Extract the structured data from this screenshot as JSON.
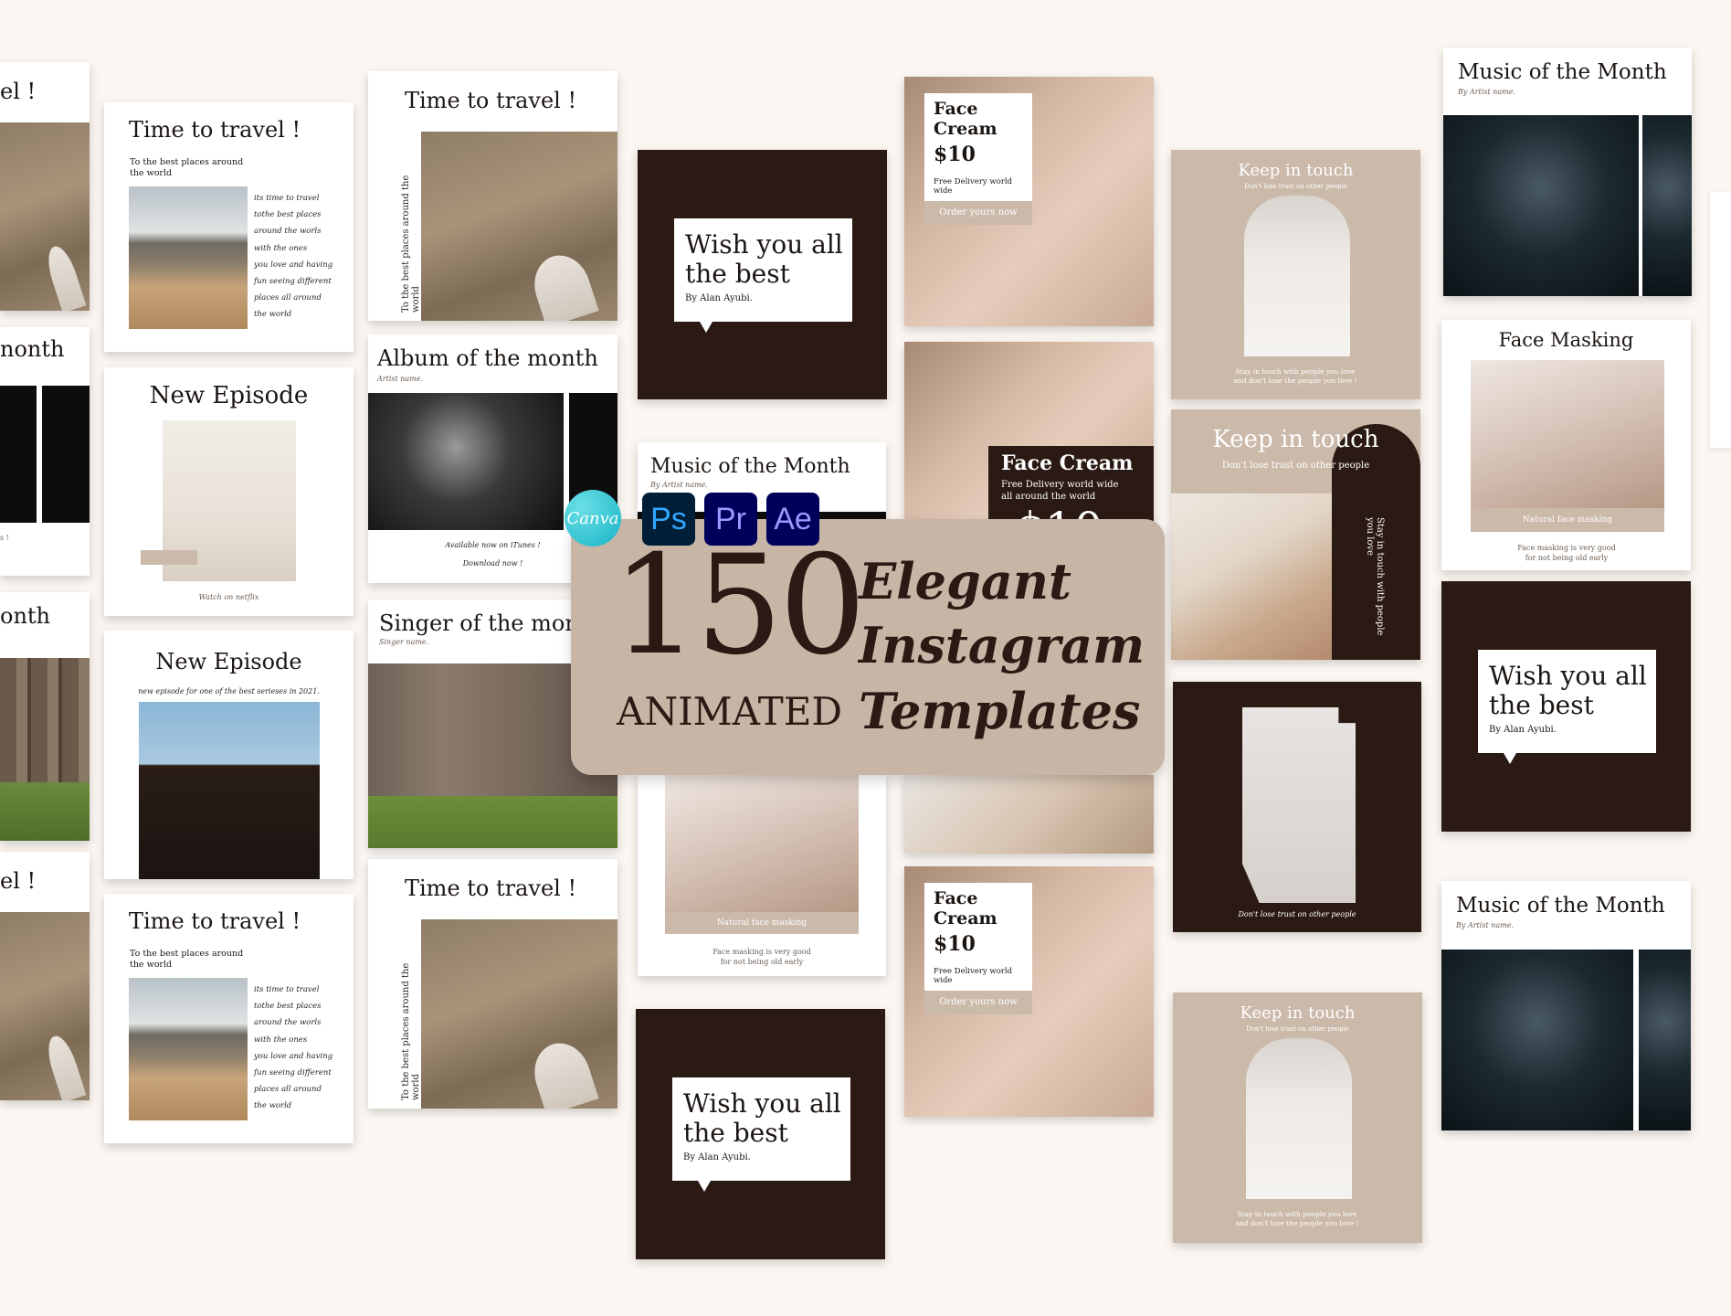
{
  "banner": {
    "number": "150",
    "animated": "ANIMATED",
    "line1": "Elegant",
    "line2": "Instagram",
    "line3": "Templates",
    "apps": [
      "Canva",
      "Ps",
      "Pr",
      "Ae"
    ]
  },
  "texts": {
    "travel_title": "Time to travel !",
    "travel_sub": "To the best places around the world",
    "travel_body": [
      "its time to travel",
      "tothe best places",
      "around the worls",
      "with the ones",
      "you love and having",
      "fun seeing different",
      "places all around",
      "the world"
    ],
    "travel_vertical": "To the best places around the world",
    "travel_cut": "el !",
    "month_cut": "nonth",
    "month_cut2": "onth",
    "episode_title": "New Episode",
    "episode_foot": "Watch on netflix",
    "episode_sub": "new episode for one of the best serieses in 2021.",
    "album_title": "Album of the month",
    "album_artist": "Artist name.",
    "album_foot1": "Available now on iTunes !",
    "album_foot2": "Download now !",
    "singer_title": "Singer of the month",
    "singer_artist": "Singer name.",
    "music_title": "Music of the Month",
    "music_artist": "By Artist name.",
    "wish_line1": "Wish you all",
    "wish_line2": "the best",
    "wish_by": "By Alan Ayubi.",
    "cream_title": "Face Cream",
    "cream_price": "$10",
    "cream_delivery": "Free Delivery world wide",
    "cream_order": "Order yours now",
    "cream2_delivery": "Free Delivery world wide all around the world",
    "cream2_price_partial": "$10",
    "keep_title": "Keep in touch",
    "keep_sub": "Don't lose trust on other people",
    "keep_foot": "Stay in touch with people you love and don't lose the people you love !",
    "keep2_sub": "Don't lose trust on other people",
    "keep2_vertical": "Stay in touch with people you love",
    "family_foot": "Don't lose trust on other people",
    "mask_title": "Face Masking",
    "mask_label": "Natural face masking",
    "mask_foot": "Face masking is very good for not being old early",
    "cut_exclaim": "s !"
  }
}
